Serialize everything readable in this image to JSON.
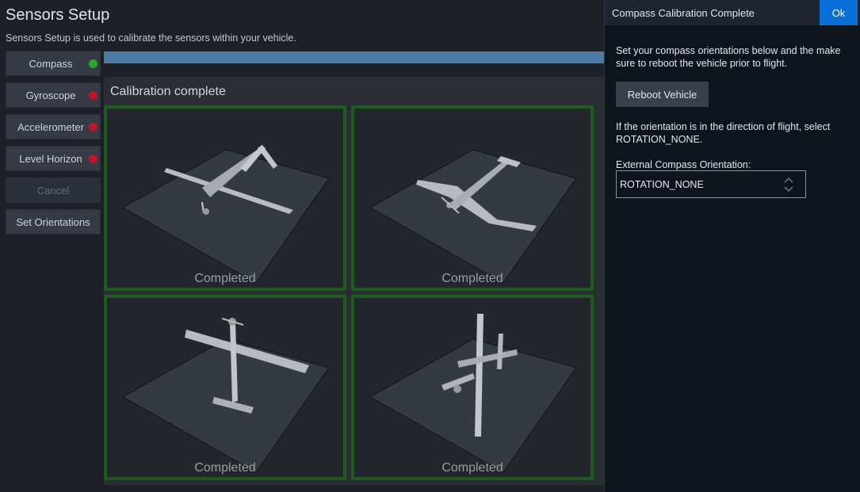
{
  "header": {
    "title": "Sensors Setup",
    "description": "Sensors Setup is used to calibrate the sensors within your vehicle."
  },
  "sidebar": {
    "items": [
      {
        "label": "Compass",
        "status": "green"
      },
      {
        "label": "Gyroscope",
        "status": "red"
      },
      {
        "label": "Accelerometer",
        "status": "red"
      },
      {
        "label": "Level Horizon",
        "status": "red"
      },
      {
        "label": "Cancel",
        "status": "disabled"
      },
      {
        "label": "Set Orientations",
        "status": "none"
      }
    ]
  },
  "progress": {
    "fraction": 1.0
  },
  "calibration": {
    "title": "Calibration complete",
    "tiles": [
      {
        "label": "Completed"
      },
      {
        "label": "Completed"
      },
      {
        "label": "Completed"
      },
      {
        "label": "Completed"
      }
    ]
  },
  "dialog": {
    "title": "Compass Calibration Complete",
    "ok_label": "Ok",
    "text1": "Set your compass orientations below and the make sure to reboot the vehicle prior to flight.",
    "reboot_label": "Reboot Vehicle",
    "text2": "If the orientation is in the direction of flight, select ROTATION_NONE.",
    "external_label": "External Compass Orientation:",
    "orientation_value": "ROTATION_NONE"
  },
  "colors": {
    "status_green": "#2ea52e",
    "status_red": "#b8192a",
    "accent_blue": "#0a70d8",
    "tile_border": "#1e5c1e"
  }
}
